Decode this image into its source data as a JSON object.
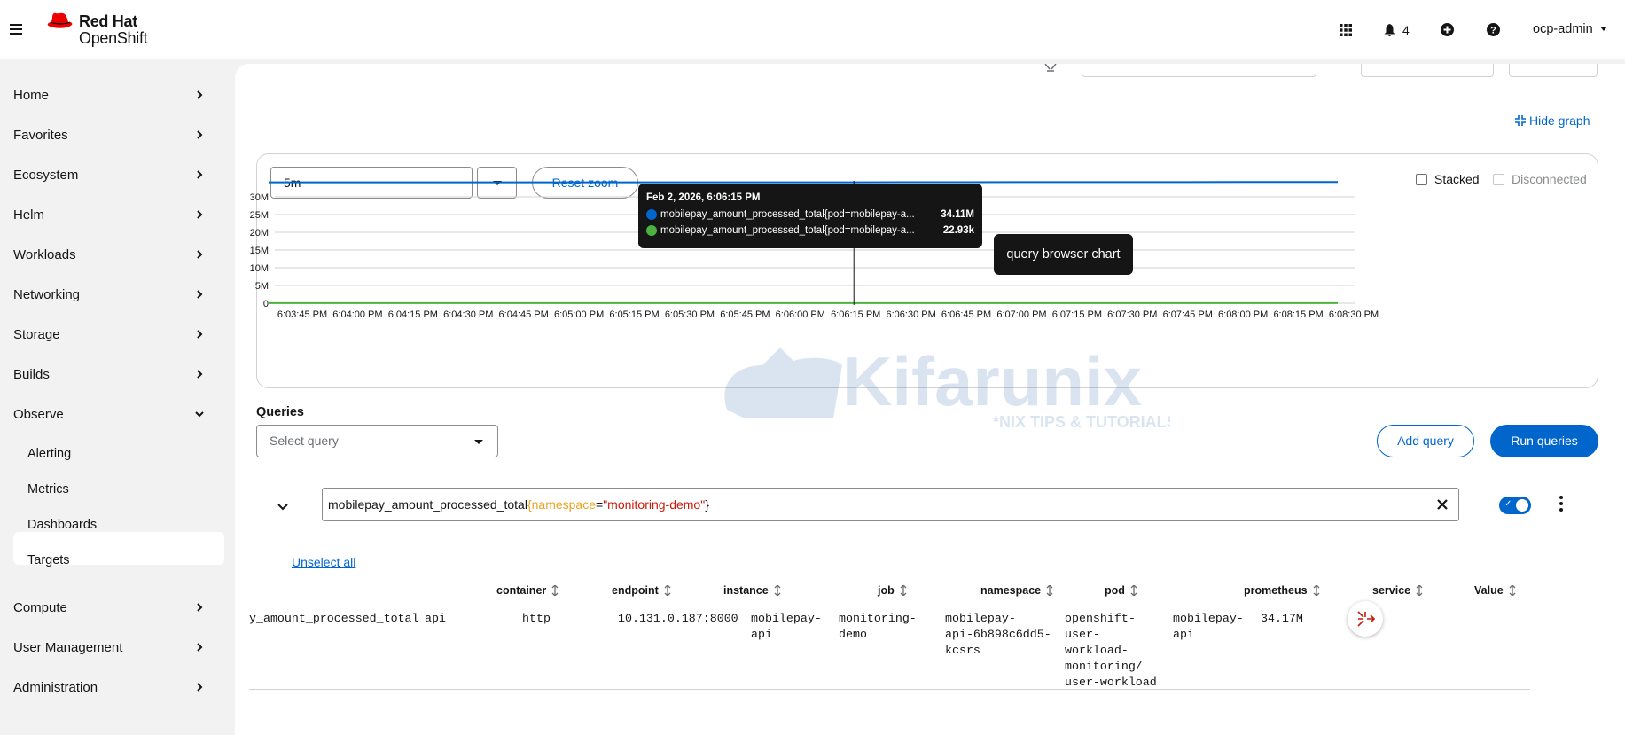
{
  "brand": {
    "line1": "Red Hat",
    "line2": "OpenShift"
  },
  "topbar": {
    "notification_count": "4",
    "user": "ocp-admin",
    "icons": [
      "apps-grid-icon",
      "bell-icon",
      "plus-circle-icon",
      "help-icon",
      "caret-down-icon"
    ]
  },
  "sidebar": {
    "items": [
      {
        "label": "Home"
      },
      {
        "label": "Favorites"
      },
      {
        "label": "Ecosystem"
      },
      {
        "label": "Helm"
      },
      {
        "label": "Workloads"
      },
      {
        "label": "Networking"
      },
      {
        "label": "Storage"
      },
      {
        "label": "Builds"
      },
      {
        "label": "Observe"
      },
      {
        "label": "Compute"
      },
      {
        "label": "User Management"
      },
      {
        "label": "Administration"
      }
    ],
    "observe_sub": [
      "Alerting",
      "Metrics",
      "Dashboards",
      "Targets"
    ],
    "active": "Metrics"
  },
  "graph": {
    "hide_graph": "Hide graph",
    "time_range": "5m",
    "reset_zoom": "Reset zoom",
    "stacked": "Stacked",
    "disconnected": "Disconnected",
    "tooltip": {
      "title": "Feb 2, 2026, 6:06:15 PM",
      "rows": [
        {
          "name": "mobilepay_amount_processed_total{pod=mobilepay-a...",
          "value": "34.11M",
          "color": "#0066cc"
        },
        {
          "name": "mobilepay_amount_processed_total{pod=mobilepay-a...",
          "value": "22.93k",
          "color": "#4cb140"
        }
      ]
    },
    "chart_label": "query browser chart"
  },
  "chart_data": {
    "type": "line",
    "title": "",
    "y_ticks": [
      "30M",
      "25M",
      "20M",
      "15M",
      "10M",
      "5M",
      "0"
    ],
    "ylim": [
      0,
      34000000
    ],
    "x_ticks": [
      "6:03:45 PM",
      "6:04:00 PM",
      "6:04:15 PM",
      "6:04:30 PM",
      "6:04:45 PM",
      "6:05:00 PM",
      "6:05:15 PM",
      "6:05:30 PM",
      "6:05:45 PM",
      "6:06:00 PM",
      "6:06:15 PM",
      "6:06:30 PM",
      "6:06:45 PM",
      "6:07:00 PM",
      "6:07:15 PM",
      "6:07:30 PM",
      "6:07:45 PM",
      "6:08:00 PM",
      "6:08:15 PM",
      "6:08:30 PM"
    ],
    "series": [
      {
        "values": [
          34110000,
          34110000,
          34110000,
          34110000,
          34110000,
          34110000,
          34110000,
          34110000,
          34110000,
          34110000,
          34110000,
          34120000,
          34130000,
          34140000,
          34150000,
          34160000,
          34160000,
          34170000,
          34170000,
          34170000
        ],
        "color": "#0066cc"
      },
      {
        "values": [
          22930,
          22930,
          22930,
          22930,
          22930,
          22930,
          22930,
          22930,
          22930,
          22930,
          22930,
          22930,
          22930,
          22930,
          22930,
          22930,
          22930,
          22930,
          22930,
          22930
        ],
        "color": "#4cb140"
      }
    ],
    "cursor_x": "6:06:15 PM",
    "grid": true
  },
  "queries": {
    "title": "Queries",
    "select_placeholder": "Select query",
    "add_query": "Add query",
    "run_queries": "Run queries",
    "expression": {
      "metric": "mobilepay_amount_processed_total",
      "open": "{",
      "label": "namespace",
      "eq": "=",
      "value": "\"monitoring-demo\"",
      "close": "}"
    },
    "unselect_all": "Unselect all"
  },
  "table": {
    "columns": [
      "container",
      "endpoint",
      "instance",
      "job",
      "namespace",
      "pod",
      "prometheus",
      "service",
      "Value"
    ],
    "row": {
      "name": "y_amount_processed_total",
      "container": "api",
      "endpoint": "http",
      "instance": "10.131.0.187:8000",
      "job": "mobilepay-\napi",
      "namespace": "monitoring-\ndemo",
      "pod": "mobilepay-\napi-6b898c6dd5-\nkcsrs",
      "prometheus": "openshift-\nuser-\nworkload-\nmonitoring/\nuser-workload",
      "service": "mobilepay-\napi",
      "value": "34.17M"
    }
  },
  "watermark": {
    "text": "Kifarunix",
    "tagline": "*NIX TIPS & TUTORIALS"
  }
}
